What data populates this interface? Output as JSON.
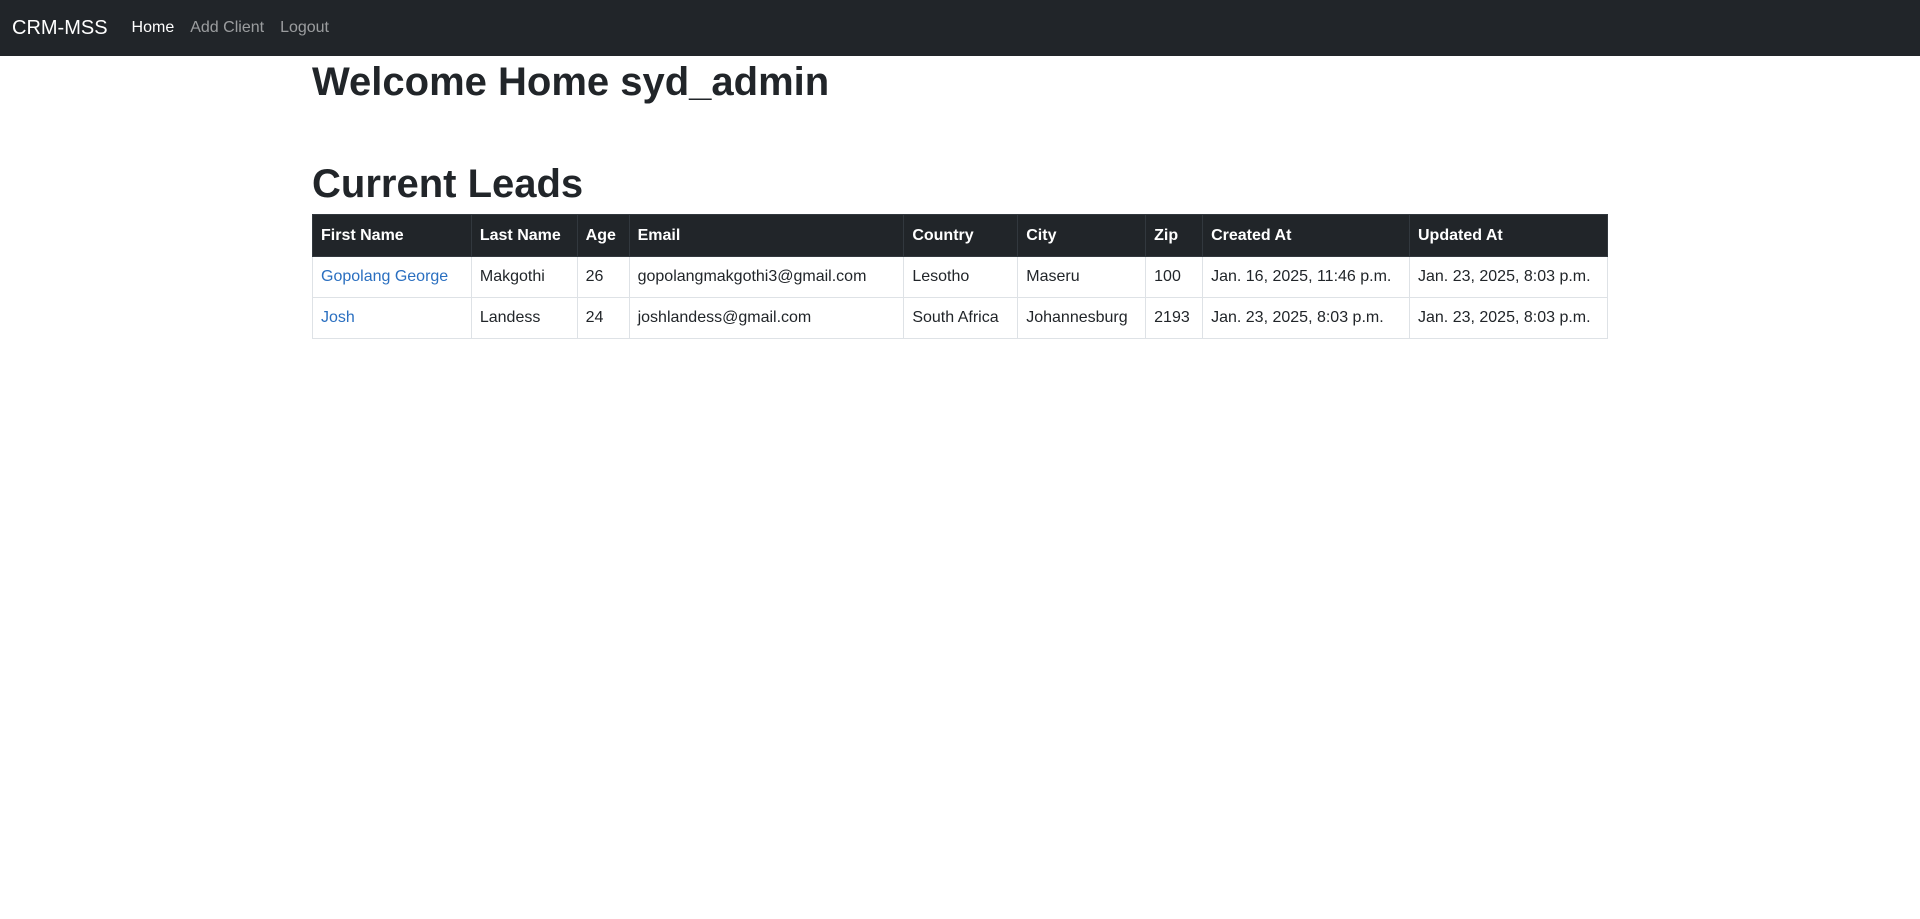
{
  "navbar": {
    "brand": "CRM-MSS",
    "links": [
      {
        "label": "Home",
        "active": true
      },
      {
        "label": "Add Client",
        "active": false
      },
      {
        "label": "Logout",
        "active": false
      }
    ]
  },
  "main": {
    "welcome": "Welcome Home syd_admin",
    "leads_title": "Current Leads"
  },
  "table": {
    "headers": [
      "First Name",
      "Last Name",
      "Age",
      "Email",
      "Country",
      "City",
      "Zip",
      "Created At",
      "Updated At"
    ],
    "rows": [
      [
        "Gopolang George",
        "Makgothi",
        "26",
        "gopolangmakgothi3@gmail.com",
        "Lesotho",
        "Maseru",
        "100",
        "Jan. 16, 2025, 11:46 p.m.",
        "Jan. 23, 2025, 8:03 p.m."
      ],
      [
        "Josh",
        "Landess",
        "24",
        "joshlandess@gmail.com",
        "South Africa",
        "Johannesburg",
        "2193",
        "Jan. 23, 2025, 8:03 p.m.",
        "Jan. 23, 2025, 8:03 p.m."
      ]
    ]
  },
  "colors": {
    "navbar_bg": "#212529",
    "link": "#2a6fc0"
  }
}
